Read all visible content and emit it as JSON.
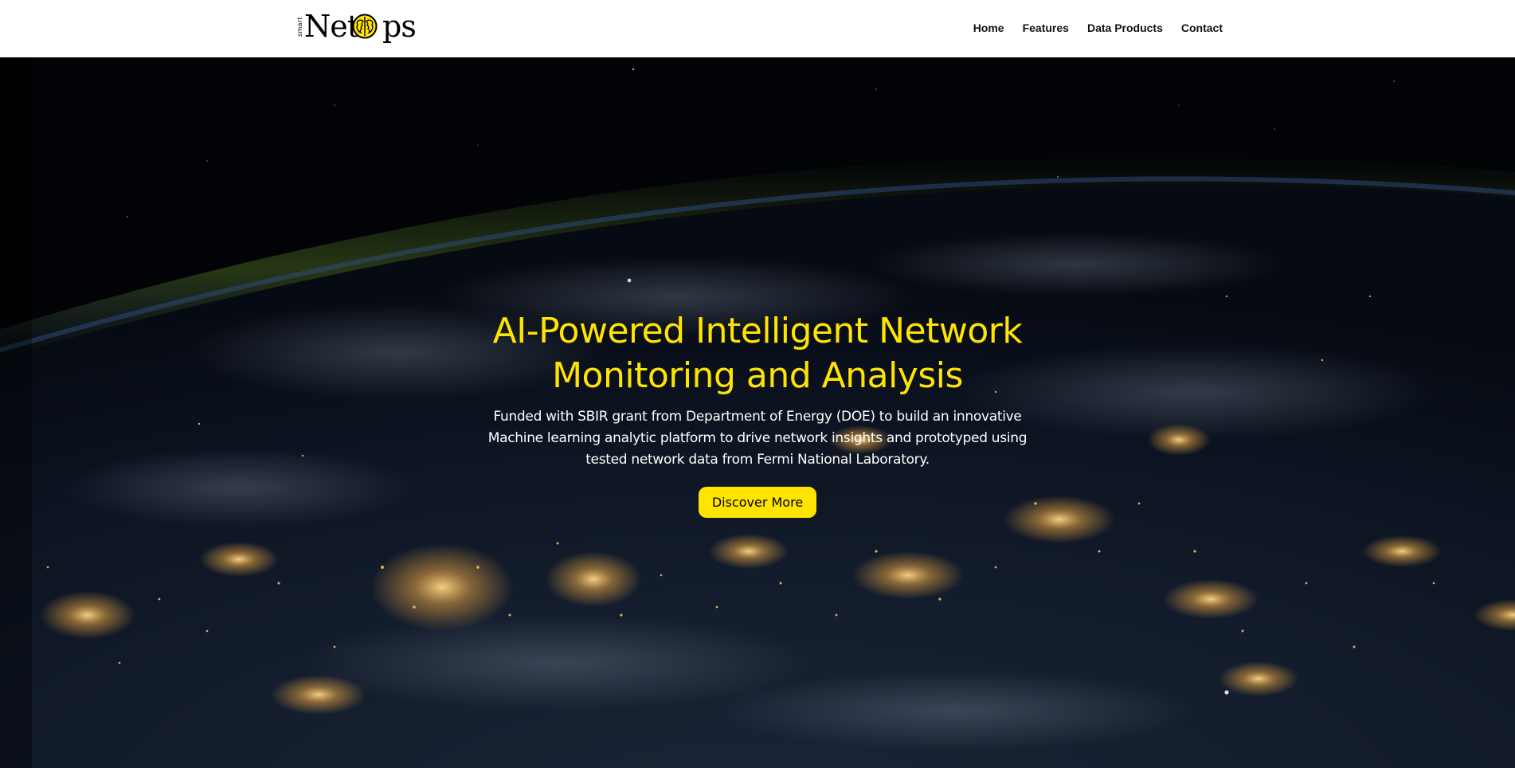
{
  "header": {
    "logo": {
      "small_text": "smart",
      "main_text_left": "Net",
      "main_text_right": "ps"
    },
    "nav": [
      {
        "label": "Home"
      },
      {
        "label": "Features"
      },
      {
        "label": "Data Products"
      },
      {
        "label": "Contact"
      }
    ]
  },
  "hero": {
    "title_line1": "AI-Powered Intelligent Network",
    "title_line2": "Monitoring and Analysis",
    "description": "Funded with SBIR grant from Department of Energy (DOE) to build an innovative Machine learning analytic platform to drive network insights and prototyped using tested network data from Fermi National Laboratory.",
    "button_label": "Discover More"
  },
  "colors": {
    "accent": "#ffe400",
    "header_bg": "#ffffff",
    "hero_bg": "#02030a",
    "text_light": "#ffffff"
  },
  "icons": {
    "logo_icon": "brain-icon"
  }
}
